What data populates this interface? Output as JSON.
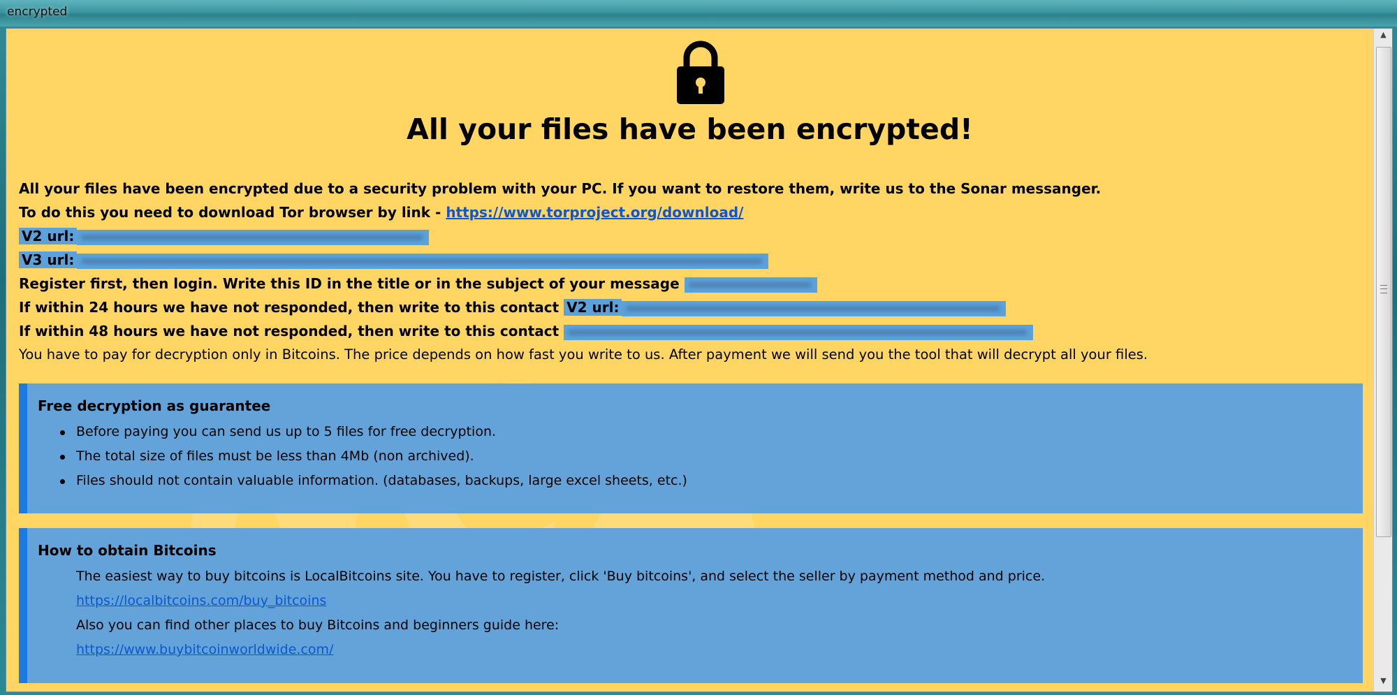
{
  "window": {
    "title": "encrypted"
  },
  "header": {
    "headline": "All your files have been encrypted!"
  },
  "message": {
    "line1": "All your files have been encrypted due to a security problem with your PC. If you want to restore them, write us to the Sonar messanger.",
    "line2_prefix": "To do this you need to download Tor browser by link - ",
    "line2_link": "https://www.torproject.org/download/",
    "v2_label": "V2 url:",
    "v3_label": "V3 url:",
    "register_text": "Register first, then login. Write this ID in the title or in the subject of your message",
    "contact24_text": "If within 24 hours we have not responded, then write to this contact",
    "contact24_label": "V2 url:",
    "contact48_text": "If within 48 hours we have not responded, then write to this contact",
    "payment_text": "You have to pay for decryption only in Bitcoins. The price depends on how fast you write to us. After payment we will send you the tool that will decrypt all your files."
  },
  "guarantee": {
    "title": "Free decryption as guarantee",
    "items": [
      "Before paying you can send us up to 5 files for free decryption.",
      "The total size of files must be less than 4Mb (non archived).",
      "Files should not contain valuable information. (databases, backups, large excel sheets, etc.)"
    ]
  },
  "bitcoins": {
    "title": "How to obtain Bitcoins",
    "text1": "The easiest way to buy bitcoins is LocalBitcoins site. You have to register, click 'Buy bitcoins', and select the seller by payment method and price.",
    "link1": "https://localbitcoins.com/buy_bitcoins",
    "text2": "Also you can find other places to buy Bitcoins and beginners guide here:",
    "link2": "https://www.buybitcoinworldwide.com/"
  },
  "watermark": {
    "main": "NCA",
    "sub": "i.n.t.e.r.n.e.t"
  },
  "icons": {
    "lock": "lock-icon"
  },
  "colors": {
    "background": "#ffd664",
    "highlight": "#5ba2dc",
    "box": "#64a3d9",
    "box_border": "#1b7be0",
    "link": "#1155cc"
  }
}
